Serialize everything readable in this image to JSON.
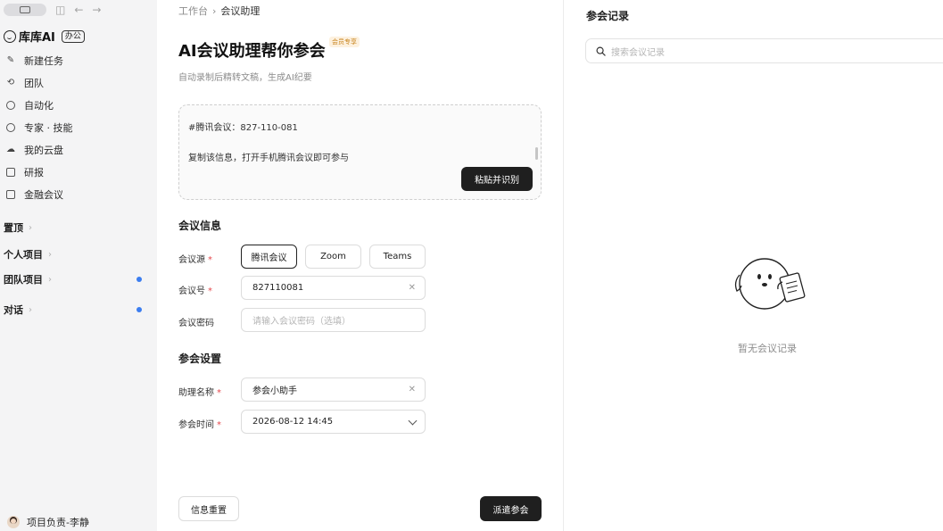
{
  "sidebar": {
    "brand": {
      "name": "库库AI",
      "tag": "办公"
    },
    "nav_items": [
      {
        "label": "新建任务",
        "icon": "edit-icon"
      },
      {
        "label": "团队",
        "icon": "team-icon"
      },
      {
        "label": "自动化",
        "icon": "clock-icon"
      },
      {
        "label": "专家 · 技能",
        "icon": "expert-icon"
      },
      {
        "label": "我的云盘",
        "icon": "cloud-icon"
      },
      {
        "label": "研报",
        "icon": "report-icon"
      },
      {
        "label": "金融会议",
        "icon": "meeting-icon"
      }
    ],
    "sections": [
      {
        "label": "置顶",
        "dot": false
      },
      {
        "label": "个人项目",
        "dot": false
      },
      {
        "label": "团队项目",
        "dot": true
      },
      {
        "label": "对话",
        "dot": true
      }
    ],
    "user": {
      "name": "项目负责-李静"
    },
    "accent_dot_color": "#3b7df0"
  },
  "main": {
    "breadcrumb": {
      "root": "工作台",
      "current": "会议助理"
    },
    "title": "AI会议助理帮你参会",
    "member_badge": "会员专享",
    "subtitle": "自动录制后精转文稿，生成AI纪要",
    "paste_box": {
      "line1": "#腾讯会议：827-110-081",
      "line2": "复制该信息，打开手机腾讯会议即可参与",
      "button": "粘贴并识别"
    },
    "meeting_info": {
      "heading": "会议信息",
      "source_label": "会议源",
      "sources": [
        "腾讯会议",
        "Zoom",
        "Teams"
      ],
      "selected_source": "腾讯会议",
      "number_label": "会议号",
      "number_value": "827110081",
      "password_label": "会议密码",
      "password_placeholder": "请输入会议密码（选填）"
    },
    "join_settings": {
      "heading": "参会设置",
      "assistant_label": "助理名称",
      "assistant_value": "参会小助手",
      "time_label": "参会时间",
      "time_value": "2026-08-12 14:45"
    },
    "reset_button": "信息重置",
    "send_button": "派遣参会"
  },
  "right": {
    "title": "参会记录",
    "search_placeholder": "搜索会议记录",
    "empty_text": "暂无会议记录"
  },
  "colors": {
    "required": "#e5484d",
    "primary_button": "#1f1f1f",
    "badge_text": "#c8841e",
    "badge_bg": "#fdf1df"
  }
}
